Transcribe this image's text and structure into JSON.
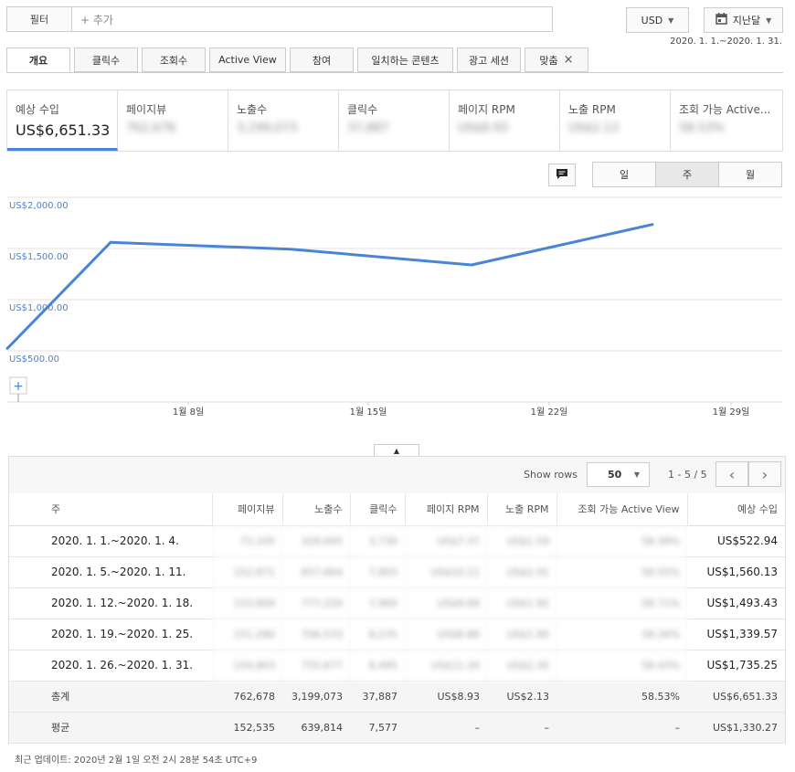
{
  "filter": {
    "label": "필터",
    "add": "+ 추가"
  },
  "currency": {
    "value": "USD"
  },
  "period": {
    "value": "지난달"
  },
  "date_range": "2020. 1. 1.~2020. 1. 31.",
  "tabs": [
    {
      "label": "개요",
      "active": true
    },
    {
      "label": "클릭수"
    },
    {
      "label": "조회수"
    },
    {
      "label": "Active View"
    },
    {
      "label": "참여"
    },
    {
      "label": "일치하는 콘텐츠"
    },
    {
      "label": "광고 세션"
    },
    {
      "label": "맞춤",
      "closable": true
    }
  ],
  "metrics": [
    {
      "label": "예상 수입",
      "value": "US$6,651.33",
      "active": true
    },
    {
      "label": "페이지뷰",
      "value": "762,678",
      "blurred": true
    },
    {
      "label": "노출수",
      "value": "3,199,073",
      "blurred": true
    },
    {
      "label": "클릭수",
      "value": "37,887",
      "blurred": true
    },
    {
      "label": "페이지 RPM",
      "value": "US$8.93",
      "blurred": true
    },
    {
      "label": "노출 RPM",
      "value": "US$2.13",
      "blurred": true
    },
    {
      "label": "조회 가능 Active...",
      "value": "58.53%",
      "blurred": true
    }
  ],
  "granularity": [
    "일",
    "주",
    "월"
  ],
  "granularity_active": 1,
  "chart_data": {
    "type": "line",
    "y_ticks": [
      "US$2,000.00",
      "US$1,500.00",
      "US$1,000.00",
      "US$500.00"
    ],
    "y_tick_values": [
      2000,
      1500,
      1000,
      500
    ],
    "x_ticks": [
      "1월 8일",
      "1월 15일",
      "1월 22일",
      "1월 29일"
    ],
    "ylim": [
      0,
      2000
    ],
    "series": [
      {
        "values": [
          522.94,
          1560.13,
          1493.43,
          1339.57,
          1735.25
        ]
      }
    ],
    "color": "#4a84d6",
    "grid": true
  },
  "table": {
    "show_rows_label": "Show rows",
    "rows_per_page": "50",
    "pager": "1 - 5 / 5",
    "columns": [
      "주",
      "페이지뷰",
      "노출수",
      "클릭수",
      "페이지 RPM",
      "노출 RPM",
      "조회 가능 Active View",
      "예상 수입"
    ],
    "rows": [
      {
        "week": "2020. 1. 1.~2020. 1. 4.",
        "blurred": [
          "73,105",
          "329,005",
          "3,730",
          "US$7.37",
          "US$1.59",
          "58.39%"
        ],
        "revenue": "US$522.94"
      },
      {
        "week": "2020. 1. 5.~2020. 1. 11.",
        "blurred": [
          "152,871",
          "657,664",
          "7,803",
          "US$10.21",
          "US$2.41",
          "58.55%"
        ],
        "revenue": "US$1,560.13"
      },
      {
        "week": "2020. 1. 12.~2020. 1. 18.",
        "blurred": [
          "153,809",
          "777,229",
          "7,960",
          "US$9.68",
          "US$1.92",
          "58.71%"
        ],
        "revenue": "US$1,493.43"
      },
      {
        "week": "2020. 1. 19.~2020. 1. 25.",
        "blurred": [
          "151,280",
          "706,533",
          "8,235",
          "US$8.86",
          "US$1.90",
          "58.26%"
        ],
        "revenue": "US$1,339.57"
      },
      {
        "week": "2020. 1. 26.~2020. 1. 31.",
        "blurred": [
          "154,803",
          "755,677",
          "8,495",
          "US$11.20",
          "US$2.30",
          "58.43%"
        ],
        "revenue": "US$1,735.25"
      }
    ],
    "total": {
      "label": "총계",
      "values": [
        "762,678",
        "3,199,073",
        "37,887",
        "US$8.93",
        "US$2.13",
        "58.53%",
        "US$6,651.33"
      ]
    },
    "average": {
      "label": "평균",
      "values": [
        "152,535",
        "639,814",
        "7,577",
        "–",
        "–",
        "–",
        "US$1,330.27"
      ]
    }
  },
  "last_updated": "최근 업데이트: 2020년 2월 1일 오전 2시 28분 54초 UTC+9",
  "icons": {
    "calendar": "calendar-icon",
    "comment": "comment-icon",
    "add": "add-annotation-icon",
    "expand": "caret-up-icon"
  }
}
